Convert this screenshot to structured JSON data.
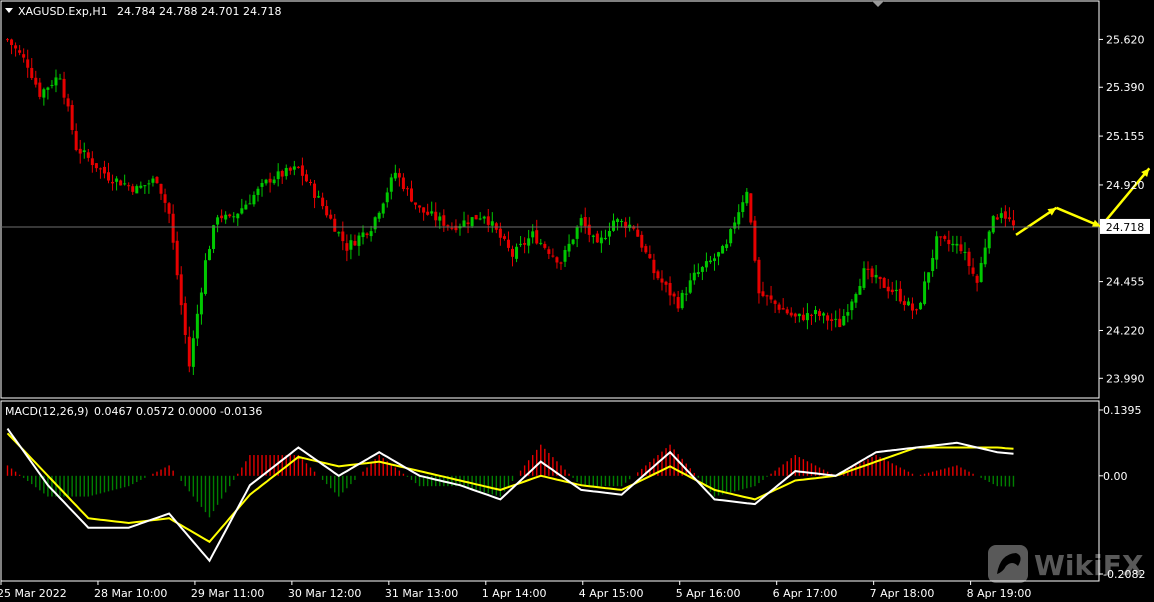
{
  "header": {
    "symbol": "XAGUSD.Exp,H1",
    "ohlc": "24.784 24.788 24.701 24.718"
  },
  "macd_header": {
    "label": "MACD(12,26,9)",
    "values": "0.0467 0.0572 0.0000 -0.0136"
  },
  "watermark": {
    "text": "WikiFX"
  },
  "colors": {
    "background": "#000000",
    "bull": "#00c800",
    "bear": "#e60000",
    "macd_line": "#ffffff",
    "signal_line": "#ffff00",
    "hist_pos": "#e60000",
    "hist_neg": "#008000",
    "price_line": "#6e6e6e",
    "arrow": "#ffff00",
    "axis": "#ffffff"
  },
  "chart_data": [
    {
      "type": "candlestick",
      "title": "XAGUSD.Exp,H1",
      "current_price": 24.718,
      "current_price_label": "24.718",
      "ylim": [
        23.9,
        25.8
      ],
      "y_ticks": [
        {
          "value": 25.62,
          "label": "25.620"
        },
        {
          "value": 25.39,
          "label": "25.390"
        },
        {
          "value": 25.155,
          "label": "25.155"
        },
        {
          "value": 24.92,
          "label": "24.920"
        },
        {
          "value": 24.455,
          "label": "24.455"
        },
        {
          "value": 24.22,
          "label": "24.220"
        },
        {
          "value": 23.99,
          "label": "23.990"
        }
      ],
      "x_ticks": [
        "25 Mar 2022",
        "28 Mar 10:00",
        "29 Mar 11:00",
        "30 Mar 12:00",
        "31 Mar 13:00",
        "1 Apr 14:00",
        "4 Apr 15:00",
        "5 Apr 16:00",
        "6 Apr 17:00",
        "7 Apr 18:00",
        "8 Apr 19:00"
      ],
      "bars_per_tick": 24,
      "bar_count": 250,
      "close_anchors": [
        [
          0,
          25.62
        ],
        [
          5,
          25.5
        ],
        [
          8,
          25.36
        ],
        [
          13,
          25.45
        ],
        [
          17,
          25.1
        ],
        [
          25,
          24.96
        ],
        [
          32,
          24.9
        ],
        [
          37,
          24.95
        ],
        [
          40,
          24.78
        ],
        [
          45,
          24.05
        ],
        [
          49,
          24.55
        ],
        [
          52,
          24.78
        ],
        [
          55,
          24.75
        ],
        [
          65,
          24.95
        ],
        [
          72,
          25.0
        ],
        [
          78,
          24.82
        ],
        [
          84,
          24.62
        ],
        [
          90,
          24.72
        ],
        [
          96,
          24.98
        ],
        [
          102,
          24.8
        ],
        [
          110,
          24.72
        ],
        [
          118,
          24.78
        ],
        [
          125,
          24.58
        ],
        [
          130,
          24.68
        ],
        [
          137,
          24.55
        ],
        [
          142,
          24.75
        ],
        [
          146,
          24.62
        ],
        [
          150,
          24.75
        ],
        [
          155,
          24.72
        ],
        [
          160,
          24.5
        ],
        [
          166,
          24.35
        ],
        [
          170,
          24.48
        ],
        [
          178,
          24.62
        ],
        [
          180,
          24.75
        ],
        [
          183,
          24.9
        ],
        [
          186,
          24.4
        ],
        [
          195,
          24.28
        ],
        [
          200,
          24.3
        ],
        [
          206,
          24.25
        ],
        [
          212,
          24.5
        ],
        [
          220,
          24.4
        ],
        [
          225,
          24.3
        ],
        [
          230,
          24.65
        ],
        [
          236,
          24.62
        ],
        [
          240,
          24.45
        ],
        [
          243,
          24.72
        ],
        [
          246,
          24.8
        ],
        [
          249,
          24.718
        ]
      ],
      "forecast_arrows": [
        {
          "from": [
            25,
            24.68
          ],
          "to": [
            35,
            24.81
          ]
        },
        {
          "from": [
            35,
            24.81
          ],
          "to": [
            46,
            24.72
          ]
        },
        {
          "from": [
            46,
            24.72
          ],
          "to": [
            58,
            25.0
          ]
        }
      ]
    },
    {
      "type": "line",
      "title": "MACD(12,26,9)",
      "ylim": [
        -0.2082,
        0.1395
      ],
      "y_ticks": [
        {
          "value": 0.1395,
          "label": "0.1395"
        },
        {
          "value": 0.0,
          "label": "0.00"
        },
        {
          "value": -0.2082,
          "label": "-0.2082"
        }
      ],
      "series": [
        {
          "key": "macd",
          "values_anchor": [
            [
              0,
              0.1
            ],
            [
              10,
              -0.02
            ],
            [
              20,
              -0.11
            ],
            [
              30,
              -0.11
            ],
            [
              40,
              -0.08
            ],
            [
              50,
              -0.18
            ],
            [
              60,
              -0.02
            ],
            [
              72,
              0.06
            ],
            [
              82,
              0.0
            ],
            [
              92,
              0.05
            ],
            [
              102,
              0.0
            ],
            [
              112,
              -0.02
            ],
            [
              122,
              -0.05
            ],
            [
              132,
              0.03
            ],
            [
              142,
              -0.03
            ],
            [
              152,
              -0.04
            ],
            [
              164,
              0.05
            ],
            [
              175,
              -0.05
            ],
            [
              185,
              -0.06
            ],
            [
              195,
              0.01
            ],
            [
              205,
              0.0
            ],
            [
              215,
              0.05
            ],
            [
              225,
              0.06
            ],
            [
              235,
              0.07
            ],
            [
              245,
              0.05
            ],
            [
              249,
              0.0467
            ]
          ]
        },
        {
          "key": "signal",
          "values_anchor": [
            [
              0,
              0.09
            ],
            [
              10,
              0.0
            ],
            [
              20,
              -0.09
            ],
            [
              30,
              -0.1
            ],
            [
              40,
              -0.09
            ],
            [
              50,
              -0.14
            ],
            [
              60,
              -0.04
            ],
            [
              72,
              0.04
            ],
            [
              82,
              0.02
            ],
            [
              92,
              0.03
            ],
            [
              102,
              0.01
            ],
            [
              112,
              -0.01
            ],
            [
              122,
              -0.03
            ],
            [
              132,
              0.0
            ],
            [
              142,
              -0.02
            ],
            [
              152,
              -0.03
            ],
            [
              164,
              0.02
            ],
            [
              175,
              -0.03
            ],
            [
              185,
              -0.05
            ],
            [
              195,
              -0.01
            ],
            [
              205,
              0.0
            ],
            [
              215,
              0.03
            ],
            [
              225,
              0.06
            ],
            [
              235,
              0.06
            ],
            [
              245,
              0.06
            ],
            [
              249,
              0.0572
            ]
          ]
        }
      ]
    }
  ]
}
